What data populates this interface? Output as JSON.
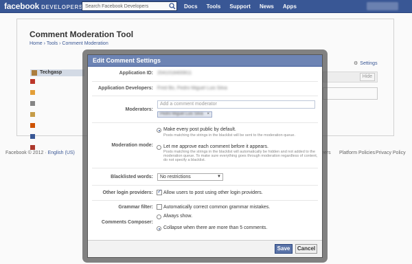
{
  "topbar": {
    "brand": "facebook",
    "brand_sub": "DEVELOPERS",
    "search_placeholder": "Search Facebook Developers",
    "nav": [
      "Docs",
      "Tools",
      "Support",
      "News",
      "Apps"
    ]
  },
  "page": {
    "title": "Comment Moderation Tool",
    "breadcrumb": [
      "Home",
      "Tools",
      "Comment Moderation"
    ],
    "breadcrumb_sep": "›",
    "settings_label": "Settings",
    "app_name": "Techgasp",
    "hide_label": "Hide"
  },
  "footer": {
    "copyright": "Facebook © 2012 ·",
    "language": "English (US)",
    "links": [
      "eers",
      "Platform Policies",
      "Privacy Policy"
    ]
  },
  "dialog": {
    "title": "Edit Comment Settings",
    "application_id_label": "Application ID:",
    "application_id_value": "2041018400811",
    "developers_label": "Application Developers:",
    "developers_value": "Fred Bo, Pedro Miguel Luis Silva",
    "moderators_label": "Moderators:",
    "moderator_placeholder": "Add a comment moderator",
    "moderator_token": "Pedro Miguel Luis Silva",
    "moderator_token_remove": "×",
    "moderation_mode_label": "Moderation mode:",
    "mode_public": "Make every post public by default.",
    "mode_public_hint": "Posts matching the strings in the blacklist will be sent to the moderation queue.",
    "mode_approve": "Let me approve each comment before it appears.",
    "mode_approve_hint": "Posts matching the strings in the blacklist will automatically be hidden and not added to the moderation queue. To make sure everything goes through moderation regardless of content, do not specify a blacklist.",
    "blacklisted_label": "Blacklisted words:",
    "blacklisted_value": "No restrictions",
    "other_login_label": "Other login providers:",
    "other_login_option": "Allow users to post using other login providers.",
    "grammar_label": "Grammar filter:",
    "grammar_option": "Automatically correct common grammar mistakes.",
    "composer_label": "Comments Composer:",
    "composer_always": "Always show.",
    "composer_collapse": "Collapse when there are more than 5 comments.",
    "save_label": "Save",
    "cancel_label": "Cancel"
  },
  "colors": {
    "brand_blue": "#3b5998",
    "dialog_header": "#6d84b4"
  }
}
